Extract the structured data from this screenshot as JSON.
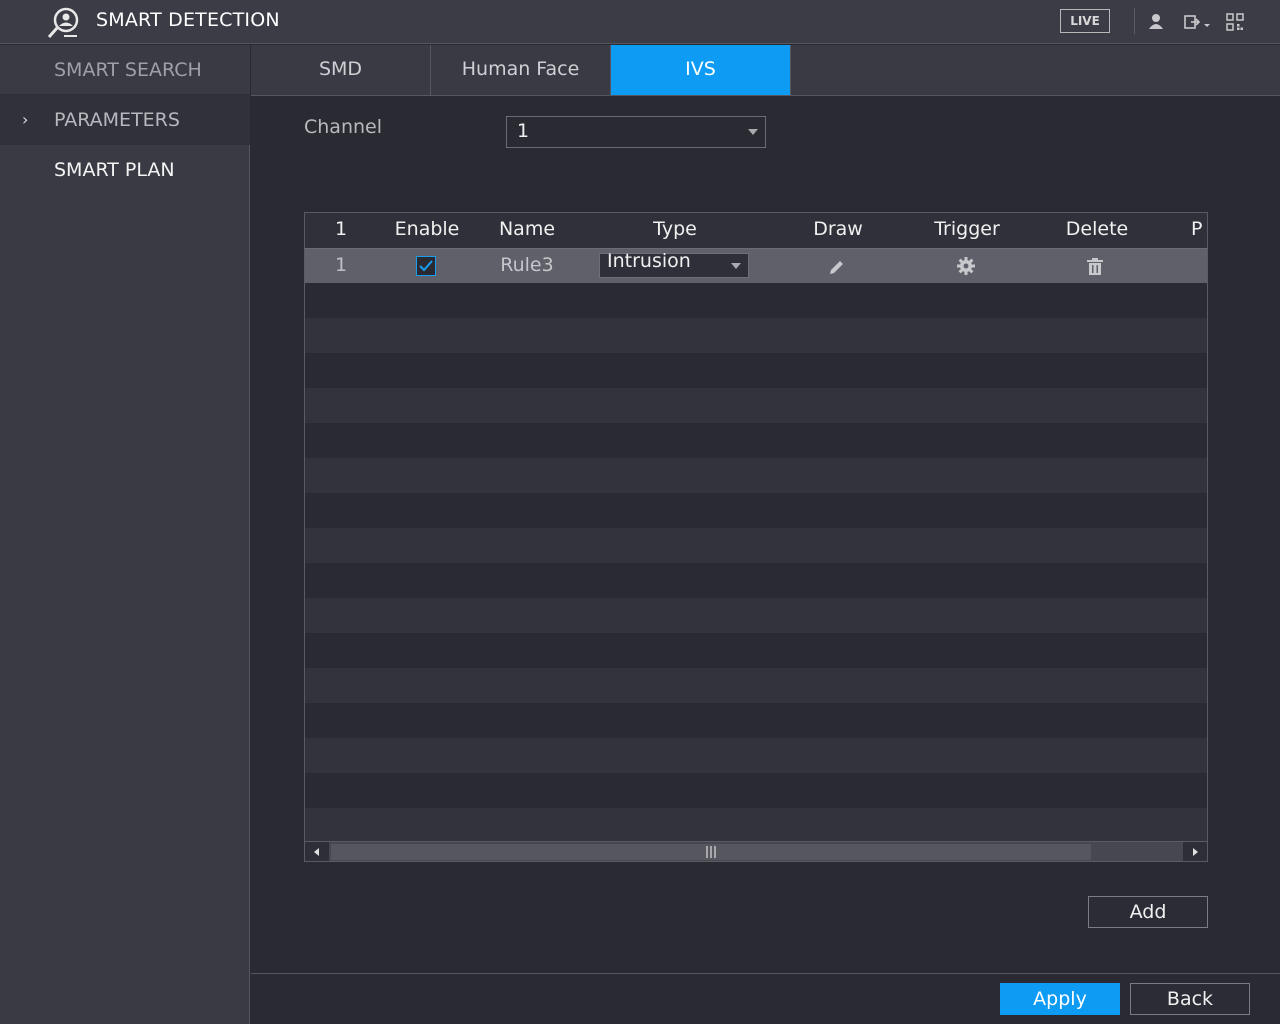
{
  "header": {
    "title": "SMART DETECTION",
    "live_label": "LIVE",
    "icons": [
      "app-logo-icon",
      "user-icon",
      "logout-icon",
      "qr-code-icon"
    ]
  },
  "sidebar": {
    "items": [
      {
        "label": "SMART SEARCH",
        "state": "normal"
      },
      {
        "label": "PARAMETERS",
        "state": "expanded"
      },
      {
        "label": "SMART PLAN",
        "state": "normal"
      }
    ],
    "arrow": "›"
  },
  "tabs": [
    {
      "label": "SMD",
      "active": false
    },
    {
      "label": "Human Face",
      "active": false
    },
    {
      "label": "IVS",
      "active": true
    }
  ],
  "channel": {
    "label": "Channel",
    "value": "1"
  },
  "table": {
    "columns": [
      "1",
      "Enable",
      "Name",
      "Type",
      "Draw",
      "Trigger",
      "Delete",
      "P"
    ],
    "rows": [
      {
        "index": "1",
        "enabled": true,
        "name": "Rule3",
        "type": "Intrusion",
        "draw_icon": "pencil-icon",
        "trigger_icon": "gear-icon",
        "delete_icon": "trash-icon"
      }
    ]
  },
  "buttons": {
    "add": "Add",
    "apply": "Apply",
    "back": "Back"
  },
  "colors": {
    "accent": "#0e9bf4",
    "background": "#2a2a33",
    "panel": "#393a44"
  }
}
